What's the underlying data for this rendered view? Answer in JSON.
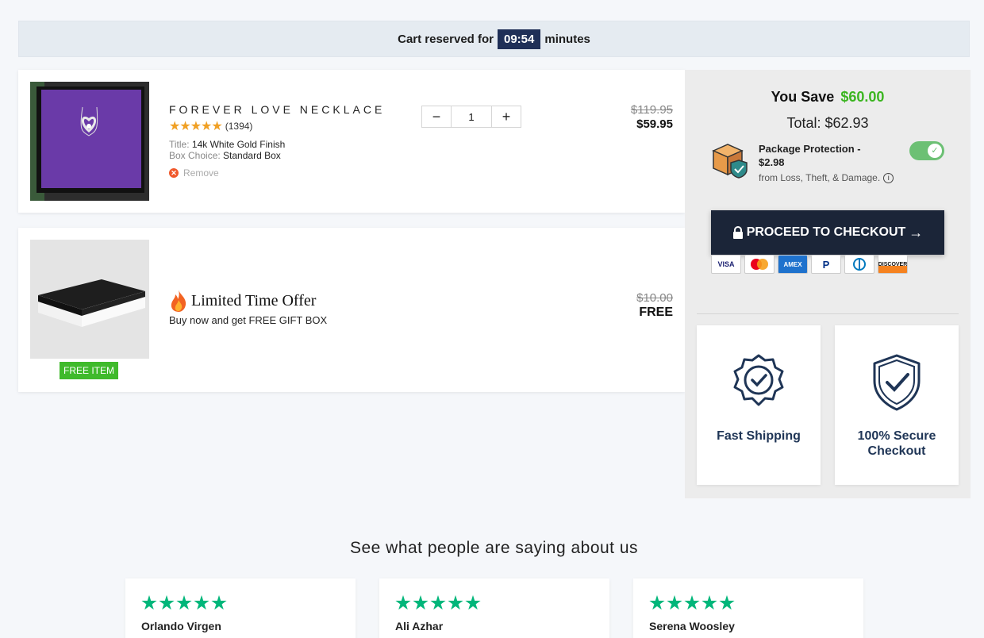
{
  "banner": {
    "prefix": "Cart reserved for",
    "timer": "09:54",
    "suffix": "minutes"
  },
  "cart_items": [
    {
      "name": "FOREVER LOVE NECKLACE",
      "rating_stars": "★★★★★",
      "review_count": "(1394)",
      "option1_label": "Title:",
      "option1_value": "14k White Gold Finish",
      "option2_label": "Box Choice:",
      "option2_value": "Standard Box",
      "remove_label": "Remove",
      "quantity": "1",
      "price_old": "$119.95",
      "price_new": "$59.95"
    },
    {
      "offer_title": "Limited Time Offer",
      "offer_sub": "Buy now and get FREE GIFT BOX",
      "badge": "FREE ITEM",
      "price_old": "$10.00",
      "price_new": "FREE"
    }
  ],
  "summary": {
    "you_save_label": "You Save",
    "you_save_amount": "$60.00",
    "total": "Total: $62.93",
    "protection_title": "Package Protection - $2.98",
    "protection_sub": "from Loss, Theft, & Damage.",
    "protection_enabled": true,
    "checkout_label": "PROCEED TO CHECKOUT",
    "payments": [
      "VISA",
      "MC",
      "AMEX",
      "PayPal",
      "Diners",
      "DISCOVER"
    ]
  },
  "features": [
    {
      "label": "Fast Shipping",
      "icon": "badge-check-icon"
    },
    {
      "label": "100% Secure Checkout",
      "icon": "shield-check-icon"
    }
  ],
  "reviews": {
    "title": "See what people are saying about us",
    "items": [
      {
        "name": "Orlando Virgen",
        "stars": 5
      },
      {
        "name": "Ali Azhar",
        "stars": 5
      },
      {
        "name": "Serena Woosley",
        "stars": 5
      }
    ]
  },
  "colors": {
    "navy": "#1f2f57",
    "green": "#3cb521",
    "button": "#1b2538",
    "trust_star": "#00b67a"
  }
}
